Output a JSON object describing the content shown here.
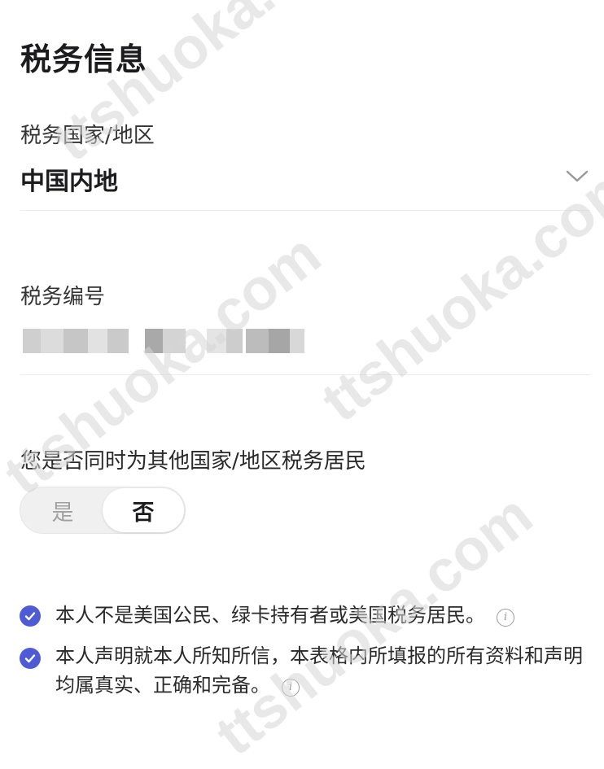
{
  "tax_info": {
    "title": "税务信息",
    "country_label": "税务国家/地区",
    "country_value": "中国内地",
    "tax_number_label": "税务编号",
    "tax_number_value": "",
    "dual_resident_question": "您是否同时为其他国家/地区税务居民",
    "dual_resident_options": [
      "是",
      "否"
    ],
    "dual_resident_selected": "否"
  },
  "declarations": [
    {
      "text": "本人不是美国公民、绿卡持有者或美国税务居民。",
      "checked": true
    },
    {
      "text": "本人声明就本人所知所信，本表格内所填报的所有资料和声明均属真实、正确和完备。",
      "checked": true
    }
  ],
  "watermark_text": "ttshuoka.com",
  "colors": {
    "check_accent": "#4f5bd5",
    "divider": "#ececec",
    "toggle_track": "#f0f0f0"
  },
  "icons": {
    "dropdown": "chevron-down-icon",
    "check": "check-circle-icon",
    "info": "info-icon"
  }
}
